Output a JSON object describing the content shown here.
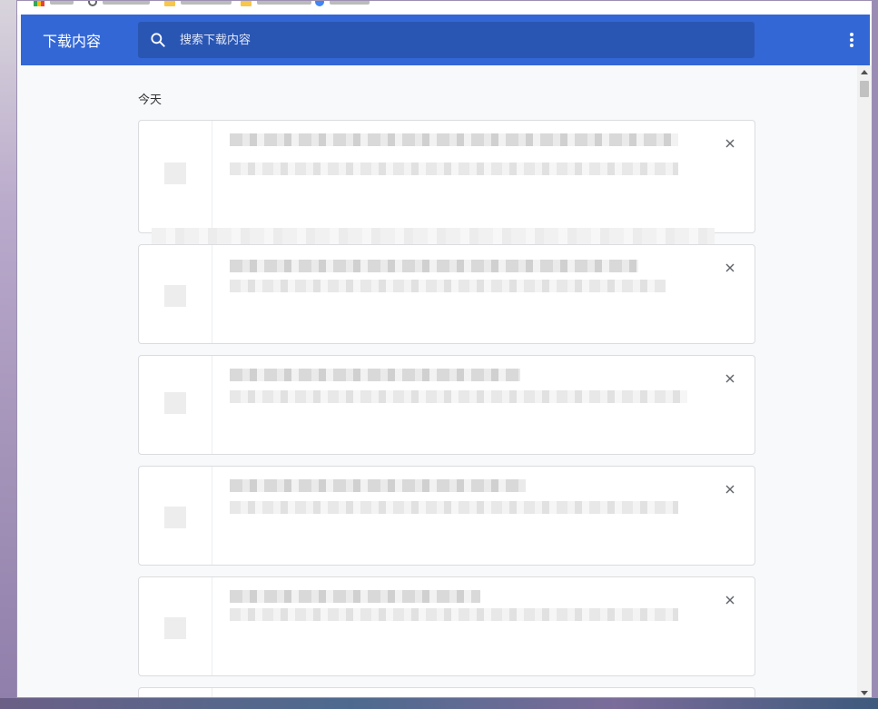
{
  "page": {
    "title": "下载内容"
  },
  "search": {
    "placeholder": "搜索下载内容"
  },
  "bookmarks": [
    {
      "icon": "apps-grid-icon"
    },
    {
      "icon": "globe-icon"
    },
    {
      "icon": "folder-icon"
    },
    {
      "icon": "folder-icon"
    },
    {
      "icon": "site-icon"
    }
  ],
  "list": {
    "date_label": "今天"
  },
  "downloads": [
    {
      "filename": "",
      "url": ""
    },
    {
      "filename": "",
      "url": ""
    },
    {
      "filename": "",
      "url": ""
    },
    {
      "filename": "",
      "url": ""
    },
    {
      "filename": "",
      "url": ""
    }
  ],
  "icons": {
    "search": "search-icon",
    "menu": "more-vert-icon",
    "remove": "close-icon"
  },
  "colors": {
    "toolbar": "#3367d6",
    "search_bg": "#2a56b3",
    "content_bg": "#f8f9fa",
    "card_border": "#dadce0"
  }
}
